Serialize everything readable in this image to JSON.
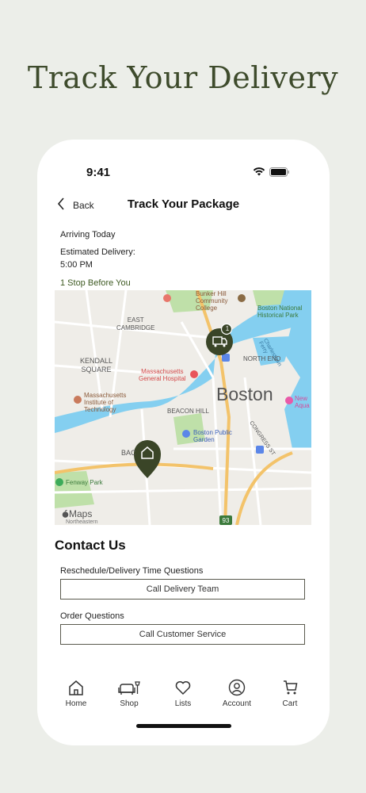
{
  "headline": "Track Your Delivery",
  "status_bar": {
    "time": "9:41"
  },
  "nav": {
    "back_label": "Back",
    "title": "Track Your Package"
  },
  "delivery": {
    "arriving": "Arriving Today",
    "estimate_label": "Estimated Delivery:",
    "estimate_time": "5:00 PM",
    "stops": "1 Stop Before You"
  },
  "map": {
    "labels": {
      "bunker": "Bunker Hill",
      "community": "Community",
      "college": "College",
      "boston_national": "Boston National",
      "historical": "Historical Park",
      "east": "EAST",
      "cambridge": "CAMBRIDGE",
      "charlestown": "Charlestown Ferry",
      "kendall": "KENDALL",
      "square": "SQUARE",
      "mass_hosp1": "Massachusetts",
      "mass_hosp2": "General Hospital",
      "north_end": "NORTH END",
      "mit1": "Massachusetts",
      "mit2": "Institute of",
      "mit3": "Technology",
      "boston": "Boston",
      "new_aqua1": "New",
      "new_aqua2": "Aqua",
      "beacon_hill": "BEACON HILL",
      "congress": "CONGRESS ST",
      "public_garden1": "Boston Public",
      "public_garden2": "Garden",
      "back_bay": "BAC",
      "fenway": "Fenway Park",
      "maps": "Maps",
      "northeastern": "Northeastern",
      "highway": "93"
    },
    "truck_badge": "1"
  },
  "contact": {
    "title": "Contact Us",
    "q1": "Reschedule/Delivery Time Questions",
    "btn1": "Call Delivery Team",
    "q2": "Order Questions",
    "btn2": "Call Customer Service"
  },
  "tabs": [
    "Home",
    "Shop",
    "Lists",
    "Account",
    "Cart"
  ],
  "colors": {
    "brand_green": "#3e4b2c",
    "marker_green": "#3a4527",
    "water": "#84cff0",
    "park": "#bfe0a9"
  }
}
